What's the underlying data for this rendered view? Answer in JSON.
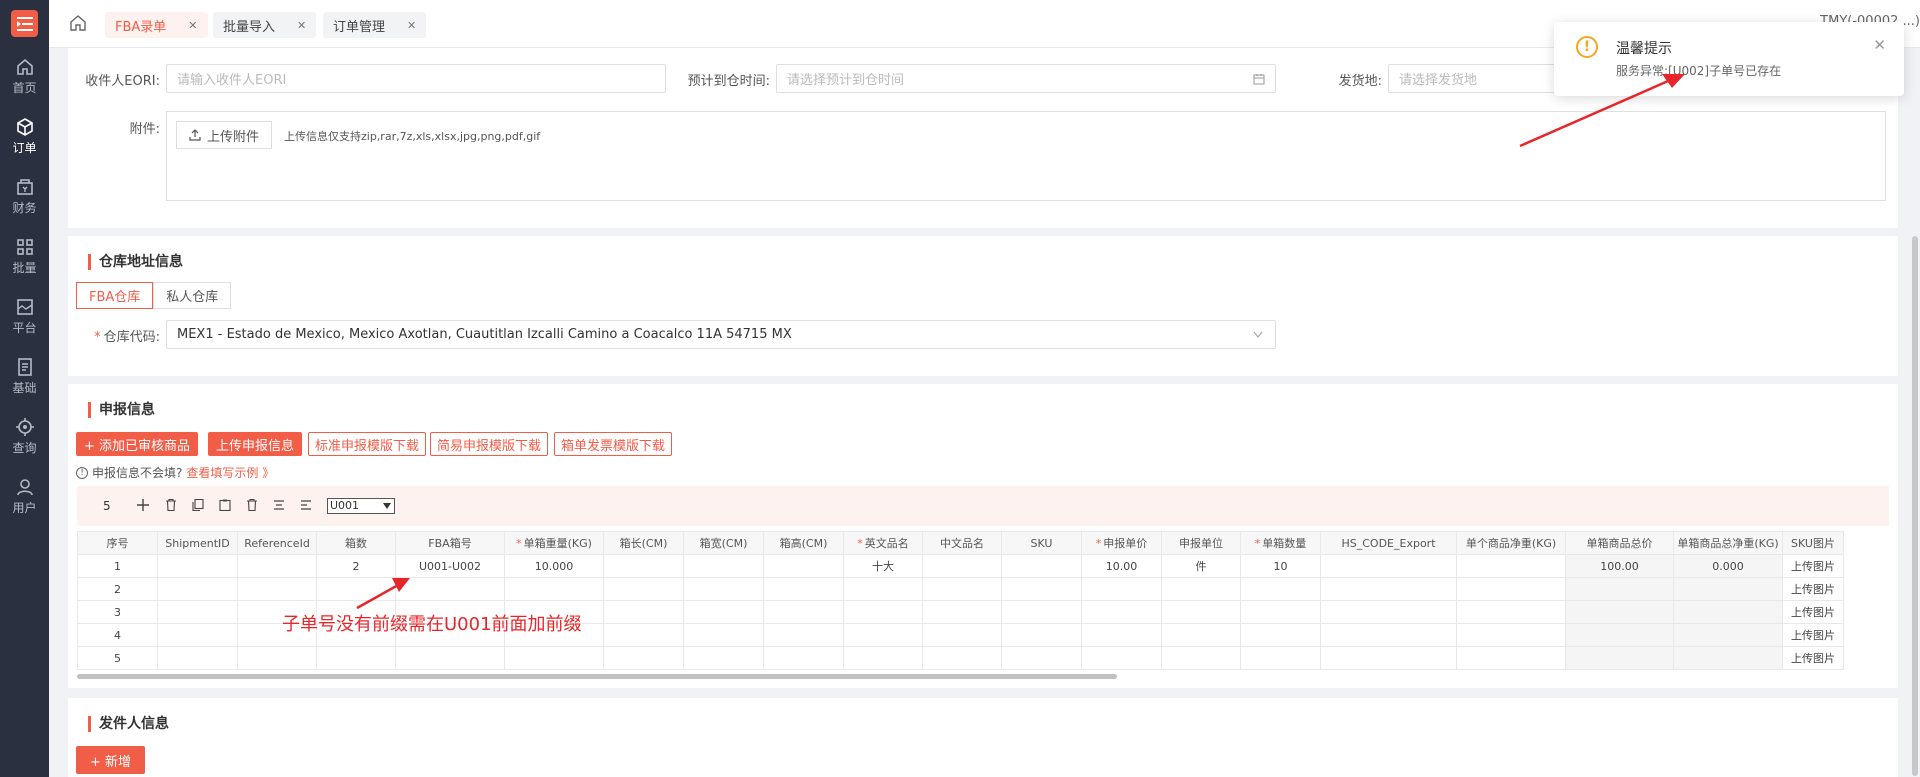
{
  "sidebar": {
    "items": [
      {
        "label": "首页",
        "icon": "home-icon"
      },
      {
        "label": "订单",
        "icon": "box-icon"
      },
      {
        "label": "财务",
        "icon": "wallet-icon"
      },
      {
        "label": "批量",
        "icon": "grid-icon"
      },
      {
        "label": "平台",
        "icon": "platform-icon"
      },
      {
        "label": "基础",
        "icon": "document-icon"
      },
      {
        "label": "查询",
        "icon": "target-icon"
      },
      {
        "label": "用户",
        "icon": "user-icon"
      }
    ]
  },
  "tabs": [
    {
      "label": "FBA录单"
    },
    {
      "label": "批量导入"
    },
    {
      "label": "订单管理"
    }
  ],
  "header": {
    "user": "TMY(-00002 ...)"
  },
  "form": {
    "eori_label": "收件人EORI:",
    "eori_placeholder": "请输入收件人EORI",
    "eta_label": "预计到仓时间:",
    "eta_placeholder": "请选择预计到仓时间",
    "ship_from_label": "发货地:",
    "ship_from_placeholder": "请选择发货地",
    "attach_label": "附件:",
    "upload_btn": "上传附件",
    "upload_hint": "上传信息仅支持zip,rar,7z,xls,xlsx,jpg,png,pdf,gif"
  },
  "warehouse": {
    "title": "仓库地址信息",
    "toggle_fba": "FBA仓库",
    "toggle_private": "私人仓库",
    "code_label": "仓库代码:",
    "code_value": "MEX1 - Estado de Mexico, Mexico Axotlan, Cuautitlan Izcalli Camino a Coacalco 11A 54715 MX"
  },
  "declare": {
    "title": "申报信息",
    "btn_add": "+ 添加已审核商品",
    "btn_upload": "上传申报信息",
    "btn_std": "标准申报模版下载",
    "btn_simple": "简易申报模版下载",
    "btn_invoice": "箱单发票模版下载",
    "help_text": "申报信息不会填?",
    "help_link": "查看填写示例 》",
    "row_count": "5",
    "select_value": "U001"
  },
  "table": {
    "headers": [
      "序号",
      "ShipmentID",
      "ReferenceId",
      "箱数",
      "FBA箱号",
      "单箱重量(KG)",
      "箱长(CM)",
      "箱宽(CM)",
      "箱高(CM)",
      "英文品名",
      "中文品名",
      "SKU",
      "申报单价",
      "申报单位",
      "单箱数量",
      "HS_CODE_Export",
      "单个商品净重(KG)",
      "单箱商品总价",
      "单箱商品总净重(KG)",
      "SKU图片"
    ],
    "required": [
      false,
      false,
      false,
      false,
      false,
      true,
      false,
      false,
      false,
      true,
      false,
      false,
      true,
      false,
      true,
      false,
      false,
      false,
      false,
      false
    ],
    "rows": [
      [
        "1",
        "",
        "",
        "2",
        "U001-U002",
        "10.000",
        "",
        "",
        "",
        "十大",
        "",
        "",
        "10.00",
        "件",
        "10",
        "",
        "",
        "100.00",
        "0.000",
        "上传图片"
      ],
      [
        "2",
        "",
        "",
        "",
        "",
        "",
        "",
        "",
        "",
        "",
        "",
        "",
        "",
        "",
        "",
        "",
        "",
        "",
        "",
        "上传图片"
      ],
      [
        "3",
        "",
        "",
        "",
        "",
        "",
        "",
        "",
        "",
        "",
        "",
        "",
        "",
        "",
        "",
        "",
        "",
        "",
        "",
        "上传图片"
      ],
      [
        "4",
        "",
        "",
        "",
        "",
        "",
        "",
        "",
        "",
        "",
        "",
        "",
        "",
        "",
        "",
        "",
        "",
        "",
        "",
        "上传图片"
      ],
      [
        "5",
        "",
        "",
        "",
        "",
        "",
        "",
        "",
        "",
        "",
        "",
        "",
        "",
        "",
        "",
        "",
        "",
        "",
        "",
        "上传图片"
      ]
    ]
  },
  "sender": {
    "title": "发件人信息",
    "btn_new": "+ 新增"
  },
  "notification": {
    "title": "温馨提示",
    "message": "服务异常:[U002]子单号已存在"
  },
  "annotation": "子单号没有前缀需在U001前面加前缀",
  "colors": {
    "accent": "#f25d48",
    "sidebar": "#2b3040",
    "annotation": "#e8262a",
    "warning": "#f5a623"
  }
}
